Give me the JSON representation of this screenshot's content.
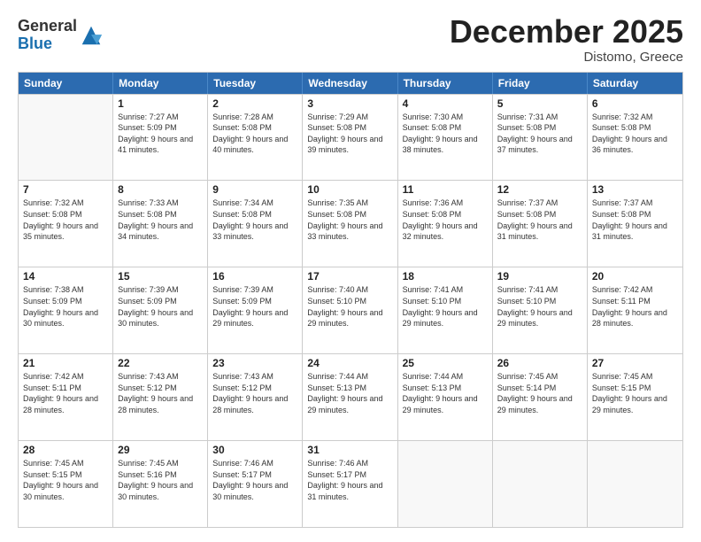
{
  "header": {
    "logo_general": "General",
    "logo_blue": "Blue",
    "month_title": "December 2025",
    "location": "Distomo, Greece"
  },
  "weekdays": [
    "Sunday",
    "Monday",
    "Tuesday",
    "Wednesday",
    "Thursday",
    "Friday",
    "Saturday"
  ],
  "rows": [
    [
      {
        "day": "",
        "sunrise": "",
        "sunset": "",
        "daylight": ""
      },
      {
        "day": "1",
        "sunrise": "Sunrise: 7:27 AM",
        "sunset": "Sunset: 5:09 PM",
        "daylight": "Daylight: 9 hours and 41 minutes."
      },
      {
        "day": "2",
        "sunrise": "Sunrise: 7:28 AM",
        "sunset": "Sunset: 5:08 PM",
        "daylight": "Daylight: 9 hours and 40 minutes."
      },
      {
        "day": "3",
        "sunrise": "Sunrise: 7:29 AM",
        "sunset": "Sunset: 5:08 PM",
        "daylight": "Daylight: 9 hours and 39 minutes."
      },
      {
        "day": "4",
        "sunrise": "Sunrise: 7:30 AM",
        "sunset": "Sunset: 5:08 PM",
        "daylight": "Daylight: 9 hours and 38 minutes."
      },
      {
        "day": "5",
        "sunrise": "Sunrise: 7:31 AM",
        "sunset": "Sunset: 5:08 PM",
        "daylight": "Daylight: 9 hours and 37 minutes."
      },
      {
        "day": "6",
        "sunrise": "Sunrise: 7:32 AM",
        "sunset": "Sunset: 5:08 PM",
        "daylight": "Daylight: 9 hours and 36 minutes."
      }
    ],
    [
      {
        "day": "7",
        "sunrise": "Sunrise: 7:32 AM",
        "sunset": "Sunset: 5:08 PM",
        "daylight": "Daylight: 9 hours and 35 minutes."
      },
      {
        "day": "8",
        "sunrise": "Sunrise: 7:33 AM",
        "sunset": "Sunset: 5:08 PM",
        "daylight": "Daylight: 9 hours and 34 minutes."
      },
      {
        "day": "9",
        "sunrise": "Sunrise: 7:34 AM",
        "sunset": "Sunset: 5:08 PM",
        "daylight": "Daylight: 9 hours and 33 minutes."
      },
      {
        "day": "10",
        "sunrise": "Sunrise: 7:35 AM",
        "sunset": "Sunset: 5:08 PM",
        "daylight": "Daylight: 9 hours and 33 minutes."
      },
      {
        "day": "11",
        "sunrise": "Sunrise: 7:36 AM",
        "sunset": "Sunset: 5:08 PM",
        "daylight": "Daylight: 9 hours and 32 minutes."
      },
      {
        "day": "12",
        "sunrise": "Sunrise: 7:37 AM",
        "sunset": "Sunset: 5:08 PM",
        "daylight": "Daylight: 9 hours and 31 minutes."
      },
      {
        "day": "13",
        "sunrise": "Sunrise: 7:37 AM",
        "sunset": "Sunset: 5:08 PM",
        "daylight": "Daylight: 9 hours and 31 minutes."
      }
    ],
    [
      {
        "day": "14",
        "sunrise": "Sunrise: 7:38 AM",
        "sunset": "Sunset: 5:09 PM",
        "daylight": "Daylight: 9 hours and 30 minutes."
      },
      {
        "day": "15",
        "sunrise": "Sunrise: 7:39 AM",
        "sunset": "Sunset: 5:09 PM",
        "daylight": "Daylight: 9 hours and 30 minutes."
      },
      {
        "day": "16",
        "sunrise": "Sunrise: 7:39 AM",
        "sunset": "Sunset: 5:09 PM",
        "daylight": "Daylight: 9 hours and 29 minutes."
      },
      {
        "day": "17",
        "sunrise": "Sunrise: 7:40 AM",
        "sunset": "Sunset: 5:10 PM",
        "daylight": "Daylight: 9 hours and 29 minutes."
      },
      {
        "day": "18",
        "sunrise": "Sunrise: 7:41 AM",
        "sunset": "Sunset: 5:10 PM",
        "daylight": "Daylight: 9 hours and 29 minutes."
      },
      {
        "day": "19",
        "sunrise": "Sunrise: 7:41 AM",
        "sunset": "Sunset: 5:10 PM",
        "daylight": "Daylight: 9 hours and 29 minutes."
      },
      {
        "day": "20",
        "sunrise": "Sunrise: 7:42 AM",
        "sunset": "Sunset: 5:11 PM",
        "daylight": "Daylight: 9 hours and 28 minutes."
      }
    ],
    [
      {
        "day": "21",
        "sunrise": "Sunrise: 7:42 AM",
        "sunset": "Sunset: 5:11 PM",
        "daylight": "Daylight: 9 hours and 28 minutes."
      },
      {
        "day": "22",
        "sunrise": "Sunrise: 7:43 AM",
        "sunset": "Sunset: 5:12 PM",
        "daylight": "Daylight: 9 hours and 28 minutes."
      },
      {
        "day": "23",
        "sunrise": "Sunrise: 7:43 AM",
        "sunset": "Sunset: 5:12 PM",
        "daylight": "Daylight: 9 hours and 28 minutes."
      },
      {
        "day": "24",
        "sunrise": "Sunrise: 7:44 AM",
        "sunset": "Sunset: 5:13 PM",
        "daylight": "Daylight: 9 hours and 29 minutes."
      },
      {
        "day": "25",
        "sunrise": "Sunrise: 7:44 AM",
        "sunset": "Sunset: 5:13 PM",
        "daylight": "Daylight: 9 hours and 29 minutes."
      },
      {
        "day": "26",
        "sunrise": "Sunrise: 7:45 AM",
        "sunset": "Sunset: 5:14 PM",
        "daylight": "Daylight: 9 hours and 29 minutes."
      },
      {
        "day": "27",
        "sunrise": "Sunrise: 7:45 AM",
        "sunset": "Sunset: 5:15 PM",
        "daylight": "Daylight: 9 hours and 29 minutes."
      }
    ],
    [
      {
        "day": "28",
        "sunrise": "Sunrise: 7:45 AM",
        "sunset": "Sunset: 5:15 PM",
        "daylight": "Daylight: 9 hours and 30 minutes."
      },
      {
        "day": "29",
        "sunrise": "Sunrise: 7:45 AM",
        "sunset": "Sunset: 5:16 PM",
        "daylight": "Daylight: 9 hours and 30 minutes."
      },
      {
        "day": "30",
        "sunrise": "Sunrise: 7:46 AM",
        "sunset": "Sunset: 5:17 PM",
        "daylight": "Daylight: 9 hours and 30 minutes."
      },
      {
        "day": "31",
        "sunrise": "Sunrise: 7:46 AM",
        "sunset": "Sunset: 5:17 PM",
        "daylight": "Daylight: 9 hours and 31 minutes."
      },
      {
        "day": "",
        "sunrise": "",
        "sunset": "",
        "daylight": ""
      },
      {
        "day": "",
        "sunrise": "",
        "sunset": "",
        "daylight": ""
      },
      {
        "day": "",
        "sunrise": "",
        "sunset": "",
        "daylight": ""
      }
    ]
  ]
}
